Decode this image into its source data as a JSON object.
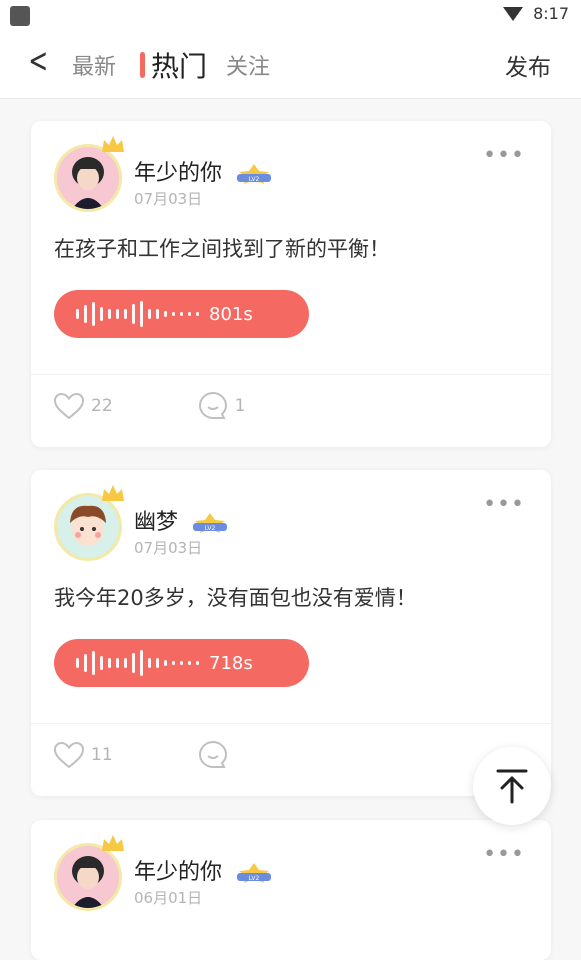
{
  "status": {
    "time": "8:17"
  },
  "nav": {
    "back_icon": "chevron-left-icon",
    "tabs": [
      {
        "label": "最新",
        "active": false
      },
      {
        "label": "热门",
        "active": true
      },
      {
        "label": "关注",
        "active": false
      }
    ],
    "publish_label": "发布"
  },
  "accent_color": "#f46a62",
  "posts": [
    {
      "username": "年少的你",
      "date": "07月03日",
      "badge_text": "LV2",
      "content": "在孩子和工作之间找到了新的平衡！",
      "voice_duration": "801s",
      "likes": "22",
      "comments": "1"
    },
    {
      "username": "幽梦",
      "date": "07月03日",
      "badge_text": "LV2",
      "content": "我今年20多岁，没有面包也没有爱情！",
      "voice_duration": "718s",
      "likes": "11",
      "comments": ""
    },
    {
      "username": "年少的你",
      "date": "06月01日",
      "badge_text": "LV2"
    }
  ],
  "more_label": "•••"
}
